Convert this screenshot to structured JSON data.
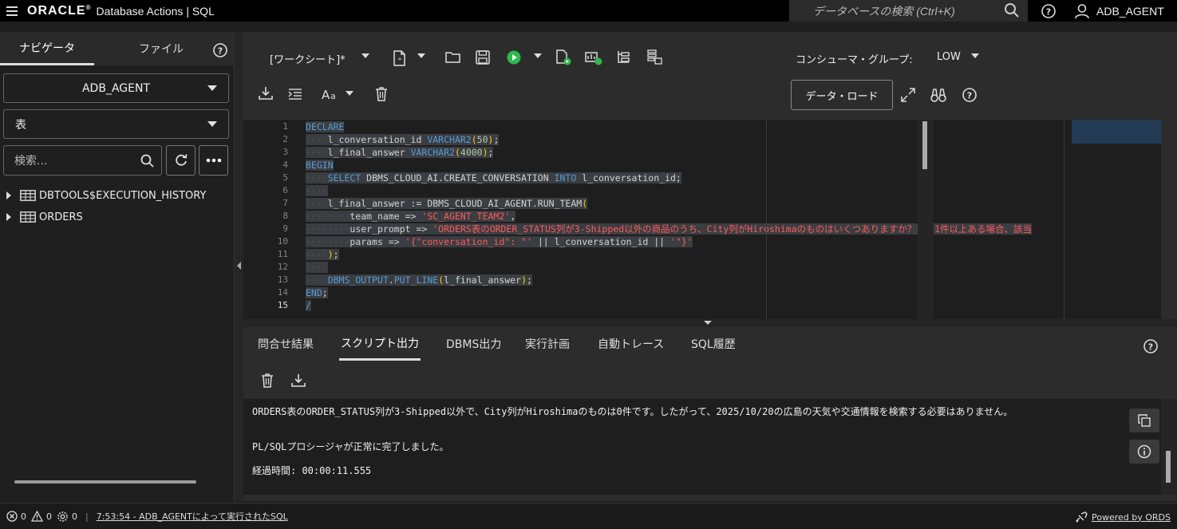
{
  "topbar": {
    "brand": "ORACLE",
    "brand_mark": "®",
    "app_title": "Database Actions |  SQL",
    "search_placeholder": "データベースの検索 (Ctrl+K)",
    "user": "ADB_AGENT"
  },
  "navigator": {
    "tabs": [
      {
        "label": "ナビゲータ",
        "active": true
      },
      {
        "label": "ファイル",
        "active": false
      }
    ],
    "schema_select": "ADB_AGENT",
    "type_select": "表",
    "search_placeholder": "検索...",
    "tree": [
      {
        "label": "DBTOOLS$EXECUTION_HISTORY"
      },
      {
        "label": "ORDERS"
      }
    ]
  },
  "toolbar": {
    "worksheet_label": "[ワークシート]*",
    "consumer_label": "コンシューマ・グループ:",
    "consumer_value": "LOW",
    "data_load_label": "データ・ロード"
  },
  "editor": {
    "line_numbers": [
      "1",
      "2",
      "3",
      "4",
      "5",
      "6",
      "7",
      "8",
      "9",
      "10",
      "11",
      "12",
      "13",
      "14",
      "15"
    ],
    "current_line": "15",
    "code": [
      [
        {
          "t": "kw",
          "v": "DECLARE"
        }
      ],
      [
        {
          "t": "ws",
          "v": "····"
        },
        {
          "t": "id",
          "v": "l_conversation_id "
        },
        {
          "t": "kw",
          "v": "VARCHAR2"
        },
        {
          "t": "par",
          "v": "("
        },
        {
          "t": "num",
          "v": "50"
        },
        {
          "t": "par",
          "v": ")"
        },
        {
          "t": "id",
          "v": ";"
        }
      ],
      [
        {
          "t": "ws",
          "v": "····"
        },
        {
          "t": "id",
          "v": "l_final_answer "
        },
        {
          "t": "kw",
          "v": "VARCHAR2"
        },
        {
          "t": "par",
          "v": "("
        },
        {
          "t": "num",
          "v": "4000"
        },
        {
          "t": "par",
          "v": ")"
        },
        {
          "t": "id",
          "v": ";"
        }
      ],
      [
        {
          "t": "kw",
          "v": "BEGIN"
        }
      ],
      [
        {
          "t": "ws",
          "v": "····"
        },
        {
          "t": "kw",
          "v": "SELECT "
        },
        {
          "t": "id",
          "v": "DBMS_CLOUD_AI.CREATE_CONVERSATION "
        },
        {
          "t": "kw",
          "v": "INTO "
        },
        {
          "t": "id",
          "v": "l_conversation_id;"
        }
      ],
      [
        {
          "t": "ws",
          "v": "····"
        }
      ],
      [
        {
          "t": "ws",
          "v": "····"
        },
        {
          "t": "id",
          "v": "l_final_answer := DBMS_CLOUD_AI_AGENT.RUN_TEAM"
        },
        {
          "t": "par",
          "v": "("
        }
      ],
      [
        {
          "t": "ws",
          "v": "········"
        },
        {
          "t": "id",
          "v": "team_name => "
        },
        {
          "t": "str",
          "v": "'SC_AGENT_TEAM2'"
        },
        {
          "t": "id",
          "v": ","
        }
      ],
      [
        {
          "t": "ws",
          "v": "········"
        },
        {
          "t": "id",
          "v": "user_prompt => "
        },
        {
          "t": "str",
          "v": "'ORDERS表のORDER_STATUS列が3-Shipped以外の商品のうち、City列がHiroshimaのものはいくつありますか？もし1件以上ある場合、該当"
        }
      ],
      [
        {
          "t": "ws",
          "v": "········"
        },
        {
          "t": "id",
          "v": "params => "
        },
        {
          "t": "str",
          "v": "'{\"conversation_id\": \"'"
        },
        {
          "t": "id",
          "v": " || l_conversation_id || "
        },
        {
          "t": "str",
          "v": "'\"}'"
        }
      ],
      [
        {
          "t": "ws",
          "v": "····"
        },
        {
          "t": "par",
          "v": ")"
        },
        {
          "t": "id",
          "v": ";"
        }
      ],
      [
        {
          "t": "ws",
          "v": "····"
        }
      ],
      [
        {
          "t": "ws",
          "v": "····"
        },
        {
          "t": "kw",
          "v": "DBMS_OUTPUT"
        },
        {
          "t": "id",
          "v": "."
        },
        {
          "t": "kw",
          "v": "PUT_LINE"
        },
        {
          "t": "par",
          "v": "("
        },
        {
          "t": "id",
          "v": "l_final_answer"
        },
        {
          "t": "par",
          "v": ")"
        },
        {
          "t": "id",
          "v": ";"
        }
      ],
      [
        {
          "t": "kw",
          "v": "END"
        },
        {
          "t": "id",
          "v": ";"
        }
      ],
      [
        {
          "t": "kw",
          "v": "/"
        }
      ]
    ]
  },
  "output": {
    "tabs": [
      {
        "label": "問合せ結果",
        "active": false
      },
      {
        "label": "スクリプト出力",
        "active": true
      },
      {
        "label": "DBMS出力",
        "active": false
      },
      {
        "label": "実行計画",
        "active": false
      },
      {
        "label": "自動トレース",
        "active": false
      },
      {
        "label": "SQL履歴",
        "active": false
      }
    ],
    "lines": [
      "ORDERS表のORDER_STATUS列が3-Shipped以外で、City列がHiroshimaのものは0件です。したがって、2025/10/20の広島の天気や交通情報を検索する必要はありません。",
      "PL/SQLプロシージャが正常に完了しました。",
      "経過時間: 00:00:11.555"
    ]
  },
  "statusbar": {
    "errors": "0",
    "warnings": "0",
    "tasks": "0",
    "message": "7:53:54 - ADB_AGENTによって実行されたSQL",
    "powered": "Powered by ORDS"
  },
  "colors": {
    "keyword": "#569cd6",
    "string": "#ff5a5a",
    "run_green": "#2db84d"
  }
}
